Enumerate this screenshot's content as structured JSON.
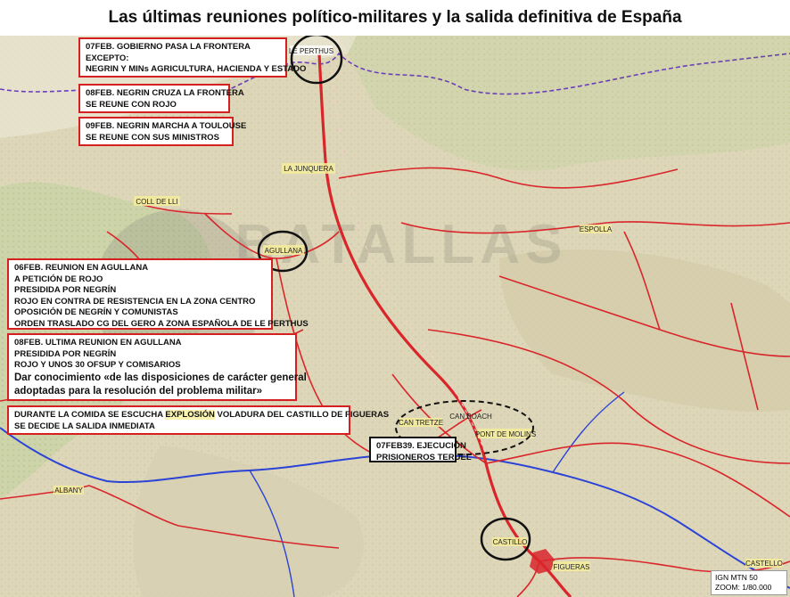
{
  "title": "Las últimas reuniones político-militares y la salida definitiva de España",
  "places": {
    "le_perthus": "LE PERTHUS",
    "la_junquera": "LA JUNQUERA",
    "coll_de_lli": "COLL DE LLI",
    "agullana": "AGULLANA",
    "espolla": "ESPOLLA",
    "can_tretze": "CAN TRETZE",
    "can_boach": "CAN BOACH",
    "pont_de_molins": "PONT DE MOLINS",
    "albanya": "ALBANY",
    "castillo": "CASTILLO",
    "figueras": "FIGUERAS",
    "castello": "CASTELLO"
  },
  "boxes": {
    "b1": [
      "07FEB. GOBIERNO PASA LA FRONTERA",
      "EXCEPTO:",
      "NEGRIN Y MINs AGRICULTURA, HACIENDA Y ESTADO"
    ],
    "b2": [
      "08FEB. NEGRIN CRUZA LA FRONTERA",
      "SE REUNE CON ROJO"
    ],
    "b3": [
      "09FEB. NEGRIN MARCHA A TOULOUSE",
      "SE REUNE CON SUS MINISTROS"
    ],
    "b4": [
      "06FEB. REUNION EN AGULLANA",
      "A PETICIÓN DE ROJO",
      "PRESIDIDA POR NEGRÍN",
      "ROJO EN CONTRA DE RESISTENCIA EN LA ZONA CENTRO",
      "OPOSICIÓN DE NEGRÍN Y COMUNISTAS",
      "ORDEN TRASLADO CG DEL GERO A ZONA ESPAÑOLA DE LE PERTHUS"
    ],
    "b5": [
      "08FEB. ULTIMA REUNION EN AGULLANA",
      "PRESIDIDA POR NEGRÍN",
      "ROJO Y UNOS 30 OFSUP Y COMISARIOS",
      "Dar conocimiento «de las disposiciones de carácter general",
      "adoptadas para la resolución del problema militar»"
    ],
    "b6_pre": "DURANTE LA COMIDA SE ESCUCHA",
    "b6_hl": "EXPLOSIÓN",
    "b6_post": "VOLADURA DEL CASTILLO DE FIGUERAS",
    "b6_line2": "SE DECIDE LA SALIDA INMEDIATA",
    "b7": [
      "07FEB39. EJECUCIÓN",
      "PRISIONEROS TERUEL"
    ]
  },
  "watermark": "BATALLAS",
  "scale": {
    "line1": "IGN MTN 50",
    "line2": "ZOOM: 1/80.000"
  },
  "colors": {
    "road": "#d9262b",
    "river": "#2b43d6",
    "frontier": "#6a3fb5",
    "box_border": "#d42020",
    "land": "#e2dcc0"
  }
}
